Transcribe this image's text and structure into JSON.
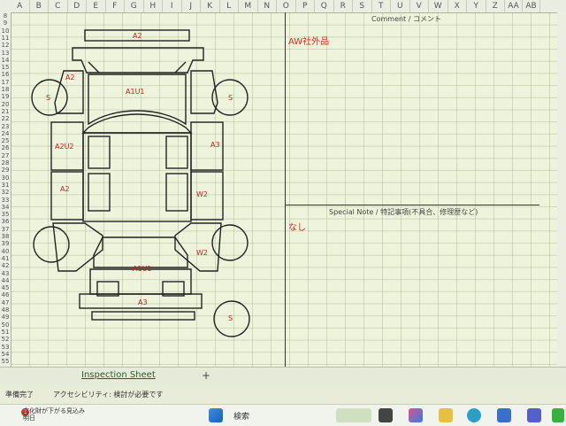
{
  "columns": [
    "A",
    "B",
    "C",
    "D",
    "E",
    "F",
    "G",
    "H",
    "I",
    "J",
    "K",
    "L",
    "M",
    "N",
    "O",
    "P",
    "Q",
    "R",
    "S",
    "T",
    "U",
    "V",
    "W",
    "X",
    "Y",
    "Z",
    "AA",
    "AB"
  ],
  "rows": [
    "8",
    "9",
    "10",
    "11",
    "12",
    "13",
    "14",
    "15",
    "16",
    "17",
    "18",
    "19",
    "20",
    "21",
    "22",
    "23",
    "24",
    "25",
    "26",
    "27",
    "28",
    "29",
    "30",
    "31",
    "32",
    "33",
    "34",
    "35",
    "36",
    "37",
    "38",
    "39",
    "40",
    "41",
    "42",
    "43",
    "44",
    "45",
    "46",
    "47",
    "48",
    "49",
    "50",
    "51",
    "52",
    "53",
    "54",
    "55"
  ],
  "comment_header": "Comment / コメント",
  "comment_text": "AW社外品",
  "special_note_header": "Special Note / 特記事項(不具合、修理歴など)",
  "special_note_text": "なし",
  "diagram_labels": {
    "roof": "A2",
    "hood": "A1U1",
    "left_front": "A2",
    "left_door1": "A2U2",
    "left_door2": "A2",
    "right_door1": "A3",
    "right_door2": "W2",
    "right_rear": "W2",
    "trunk": "A1U1",
    "rear_bumper": "A3",
    "tire_fl": "S",
    "tire_fr": "S",
    "tire_spare": "S"
  },
  "sheet_tab": "Inspection Sheet",
  "add_sheet": "+",
  "status_ready": "準備完了",
  "status_accessibility": "アクセシビリティ: 検討が必要です",
  "taskbar": {
    "weather_line1": "文化財が下がる見込み",
    "weather_line2": "明日",
    "notification_count": "3",
    "search_label": "検索"
  }
}
